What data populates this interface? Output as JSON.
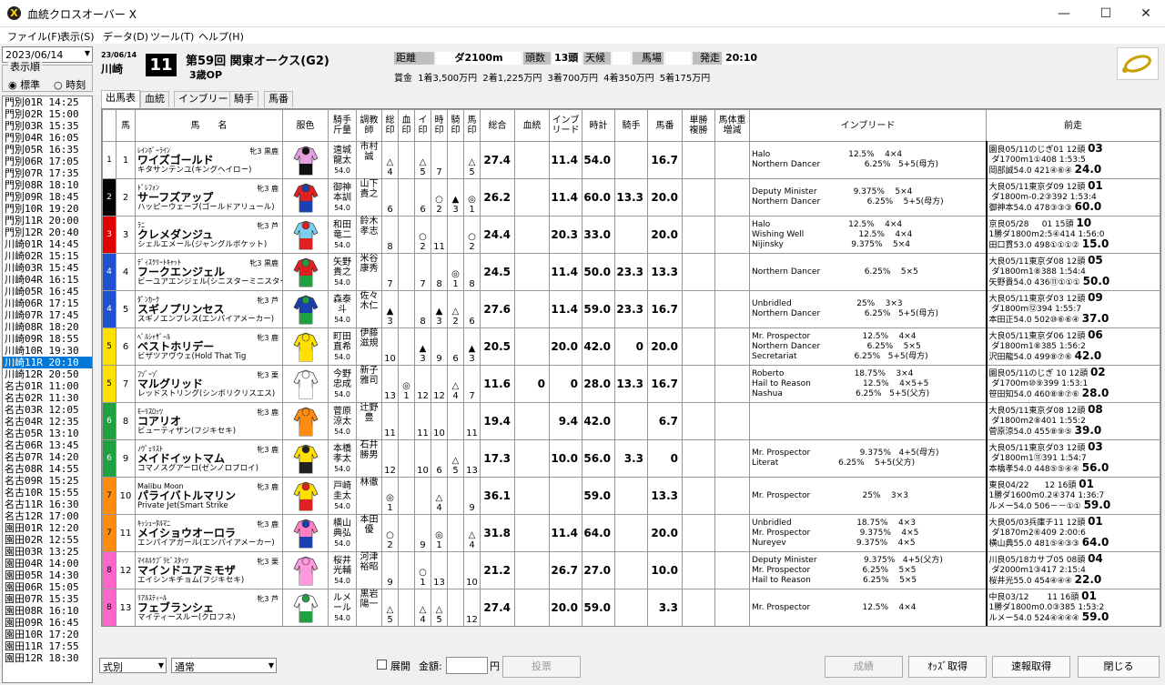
{
  "app": {
    "title": "血統クロスオーバー X",
    "win_min": "—",
    "win_max": "☐",
    "win_close": "✕"
  },
  "menu": [
    "ファイル(F)",
    "表示(S)",
    "データ(D)",
    "ツール(T)",
    "ヘルプ(H)"
  ],
  "left": {
    "date": "2023/06/14",
    "order_title": "表示順",
    "order_options": [
      "標準",
      "時刻"
    ],
    "order_selected": "標準",
    "races": [
      "門別01R 14:25",
      "門別02R 15:00",
      "門別03R 15:35",
      "門別04R 16:05",
      "門別05R 16:35",
      "門別06R 17:05",
      "門別07R 17:35",
      "門別08R 18:10",
      "門別09R 18:45",
      "門別10R 19:20",
      "門別11R 20:00",
      "門別12R 20:40",
      "川崎01R 14:45",
      "川崎02R 15:15",
      "川崎03R 15:45",
      "川崎04R 16:15",
      "川崎05R 16:45",
      "川崎06R 17:15",
      "川崎07R 17:45",
      "川崎08R 18:20",
      "川崎09R 18:55",
      "川崎10R 19:30",
      "川崎11R 20:10",
      "川崎12R 20:50",
      "名古01R 11:00",
      "名古02R 11:30",
      "名古03R 12:05",
      "名古04R 12:35",
      "名古05R 13:10",
      "名古06R 13:45",
      "名古07R 14:20",
      "名古08R 14:55",
      "名古09R 15:25",
      "名古10R 15:55",
      "名古11R 16:30",
      "名古12R 17:00",
      "園田01R 12:20",
      "園田02R 12:55",
      "園田03R 13:25",
      "園田04R 14:00",
      "園田05R 14:30",
      "園田06R 15:05",
      "園田07R 15:35",
      "園田08R 16:10",
      "園田09R 16:45",
      "園田10R 17:20",
      "園田11R 17:55",
      "園田12R 18:30"
    ],
    "selected": 22
  },
  "race": {
    "date": "23/06/14",
    "course": "川崎",
    "num": "11",
    "name": "第59回 関東オークス(G2)",
    "class": "3歳OP",
    "dist_lbl": "距離",
    "dist": "ダ2100m",
    "heads_lbl": "頭数",
    "heads": "13頭",
    "weather_lbl": "天候",
    "weather": "",
    "track_lbl": "馬場",
    "track": "",
    "start_lbl": "発走",
    "start": "20:10",
    "prize": "賞金 1着3,500万円 2着1,225万円 3着700万円 4着350万円 5着175万円"
  },
  "tabs": [
    "出馬表",
    "血統",
    "インブリード",
    "騎手",
    "馬番"
  ],
  "columns": [
    "",
    "馬",
    "馬　　名",
    "服色",
    "騎手\n斤量",
    "調教\n師",
    "総\n印",
    "血\n印",
    "イ\n印",
    "時\n印",
    "騎\n印",
    "馬\n印",
    "総合",
    "血統",
    "インブ\nリード",
    "時計",
    "騎手",
    "馬番",
    "単勝\n複勝",
    "馬体重\n増減",
    "インブリード",
    "前走"
  ],
  "horses": [
    {
      "waku": "1",
      "wc": "#ffffff",
      "wt": "#000",
      "no": "1",
      "sire": "ﾚｲﾝﾎﾞｰﾗｲﾝ",
      "name": "ワイズゴールド",
      "dam": "キタサンテンユ(キングヘイロー)",
      "sex": "牝3 黒鹿",
      "jockey": "遠城\n龍太",
      "kin": "54.0",
      "trainer": "市村\n誠",
      "m": [
        "△",
        "",
        "△",
        "",
        "",
        "△"
      ],
      "mk2": [
        "4",
        "",
        "5",
        "7",
        "",
        "5"
      ],
      "total": "27.4",
      "blood": "",
      "inbr": "11.4",
      "time": "54.0",
      "jk": "",
      "ban": "16.7",
      "inb": "Halo                              12.5%    4×4\nNorthern Dancer                 6.25%   5+5(母方)",
      "prev": "園良05/11のじぎ01 12頭 <b>03</b>\n ダ1700m1①408 1:53:5\n岡部誠54.0 421④⑥④ <b>24.0</b>",
      "silk": [
        "#111",
        "#e6a0e0",
        "#e6a0e0"
      ]
    },
    {
      "waku": "2",
      "wc": "#000000",
      "wt": "#fff",
      "no": "2",
      "sire": "ﾄﾞﾚﾌｫﾝ",
      "name": "サーフズアップ",
      "dam": "ハッピーウェーブ(ゴールドアリュール)",
      "sex": "牝3 鹿",
      "jockey": "御神\n本訓",
      "kin": "54.0",
      "trainer": "山下\n貴之",
      "m": [
        "",
        "",
        "",
        "○",
        "▲",
        "◎"
      ],
      "mk2": [
        "6",
        "",
        "6",
        "2",
        "3",
        "1"
      ],
      "total": "26.2",
      "blood": "",
      "inbr": "11.4",
      "time": "60.0",
      "jk": "13.3",
      "ban": "20.0",
      "inb": "Deputy Minister              9.375%    5×4\nNorthern Dancer                  6.25%    5+5(母方)",
      "prev": "大良05/11東京ダ09 12頭 <b>01</b>\n ダ1800m-0.2③392 1:53:4\n御神本54.0 478③③③ <b>60.0</b>",
      "silk": [
        "#1a3fb0",
        "#e02020",
        "#e02020"
      ]
    },
    {
      "waku": "3",
      "wc": "#e00000",
      "wt": "#fff",
      "no": "3",
      "sire": "ﾗﾆ",
      "name": "クレメダンジュ",
      "dam": "シェルエメール(ジャングルポケット)",
      "sex": "牝3 芦",
      "jockey": "和田\n竜二",
      "kin": "54.0",
      "trainer": "鈴木\n孝志",
      "m": [
        "",
        "",
        "○",
        "",
        "",
        "○"
      ],
      "mk2": [
        "8",
        "",
        "2",
        "11",
        "",
        "2"
      ],
      "total": "24.4",
      "blood": "",
      "inbr": "20.3",
      "time": "33.0",
      "jk": "",
      "ban": "20.0",
      "inb": "Halo                              12.5%    4×4\nWishing Well                     12.5%    4×4\nNijinsky                          9.375%    5×4",
      "prev": "京良05/28     01 15頭 <b>10</b>\n1勝ダ1800m2:5④414 1:56:0\n田口貫53.0 498①①①② <b>15.0</b>",
      "silk": [
        "#e02020",
        "#7ad0f0",
        "#7ad0f0"
      ]
    },
    {
      "waku": "4",
      "wc": "#1e50d0",
      "wt": "#fff",
      "no": "4",
      "sire": "ﾃﾞｨｽｸﾘｰﾄｷｬｯﾄ",
      "name": "フークエンジェル",
      "dam": "ビーユアエンジェル(シニスターミニスター)",
      "sex": "牝3 黒鹿",
      "jockey": "矢野\n貴之",
      "kin": "54.0",
      "trainer": "米谷\n康秀",
      "m": [
        "",
        "",
        "",
        "",
        "◎",
        ""
      ],
      "mk2": [
        "7",
        "",
        "7",
        "8",
        "1",
        "8"
      ],
      "total": "24.5",
      "blood": "",
      "inbr": "11.4",
      "time": "50.0",
      "jk": "23.3",
      "ban": "13.3",
      "inb": "Northern Dancer                 6.25%    5×5",
      "prev": "大良05/11東京ダ08 12頭 <b>05</b>\n ダ1800m1⑧388 1:54:4\n矢野貴54.0 436⑪①①① <b>50.0</b>",
      "silk": [
        "#20a040",
        "#e02020",
        "#e02020"
      ]
    },
    {
      "waku": "4",
      "wc": "#1e50d0",
      "wt": "#fff",
      "no": "5",
      "sire": "ﾀﾞﾝｶｰｸ",
      "name": "スギノプリンセス",
      "dam": "スギノエンブレス(エンパイアメーカー)",
      "sex": "牝3 芦",
      "jockey": "森泰\n斗",
      "kin": "54.0",
      "trainer": "佐々\n木仁",
      "m": [
        "▲",
        "",
        "",
        "▲",
        "△",
        ""
      ],
      "mk2": [
        "3",
        "",
        "8",
        "3",
        "2",
        "6"
      ],
      "total": "27.6",
      "blood": "",
      "inbr": "11.4",
      "time": "59.0",
      "jk": "23.3",
      "ban": "16.7",
      "inb": "Unbridled                         25%    3×3\nNorthern Dancer                 6.25%   5+5(母方)",
      "prev": "大良05/11東京ダ03 12頭 <b>09</b>\n ダ1800m⑫394 1:55:7\n本田正54.0 502⑩⑥⑥④ <b>37.0</b>",
      "silk": [
        "#20a040",
        "#1a3fb0",
        "#1a3fb0"
      ]
    },
    {
      "waku": "5",
      "wc": "#ffe000",
      "wt": "#000",
      "no": "6",
      "sire": "ﾍﾞﾙｼｬｻﾞｰﾙ",
      "name": "ベストホリデー",
      "dam": "ビザツアヴウェ(Hold That Tig",
      "sex": "牝3 鹿",
      "jockey": "町田\n直希",
      "kin": "54.0",
      "trainer": "伊藤\n滋規",
      "m": [
        "",
        "",
        "▲",
        "",
        "",
        "▲"
      ],
      "mk2": [
        "10",
        "",
        "3",
        "9",
        "6",
        "3"
      ],
      "total": "20.5",
      "blood": "",
      "inbr": "20.0",
      "time": "42.0",
      "jk": "0",
      "ban": "20.0",
      "inb": "Mr. Prospector                    12.5%    4×4\nNorthern Dancer                  6.25%    5×5\nSecretariat                      6.25%   5+5(母方)",
      "prev": "大良05/11東京ダ06 12頭 <b>06</b>\n ダ1800m1⑧385 1:56:2\n沢田龍54.0 499⑧⑦⑥ <b>42.0</b>",
      "silk": [
        "#ffe000",
        "#ffe000",
        "#ffe000"
      ]
    },
    {
      "waku": "5",
      "wc": "#ffe000",
      "wt": "#000",
      "no": "7",
      "sire": "ﾌｿﾞｰｿﾞ",
      "name": "マルグリッド",
      "dam": "レッドストリング(シンボリクリスエス)",
      "sex": "牝3 栗",
      "jockey": "今野\n忠成",
      "kin": "54.0",
      "trainer": "新子\n雅司",
      "m": [
        "",
        "◎",
        "",
        "",
        "△",
        ""
      ],
      "mk2": [
        "13",
        "1",
        "12",
        "12",
        "4",
        "7"
      ],
      "total": "11.6",
      "blood": "0",
      "inbr": "0",
      "time": "28.0",
      "jk": "13.3",
      "ban": "16.7",
      "inb": "Roberto                           18.75%    3×4\nHail to Reason                    12.5%    4×5+5\nNashua                            6.25%   5+5(父方)",
      "prev": "園良05/11のじぎ 10 12頭 <b>02</b>\n ダ1700m⑩⑨399 1:53:1\n笹田知54.0 460⑧⑧⑦⑥ <b>28.0</b>",
      "silk": [
        "#ffffff",
        "#ffffff",
        "#ffffff"
      ]
    },
    {
      "waku": "6",
      "wc": "#20a040",
      "wt": "#fff",
      "no": "8",
      "sire": "ﾓｰﾘｽﾛｯﾂ",
      "name": "コアリオ",
      "dam": "ビューティザン(フジキセキ)",
      "sex": "牝3 鹿",
      "jockey": "菅原\n涼太",
      "kin": "54.0",
      "trainer": "辻野\n豊",
      "m": [
        "",
        "",
        "",
        "",
        "",
        ""
      ],
      "mk2": [
        "11",
        "",
        "11",
        "10",
        "",
        "11"
      ],
      "total": "19.4",
      "blood": "",
      "inbr": "9.4",
      "time": "42.0",
      "jk": "",
      "ban": "6.7",
      "inb": "",
      "prev": "大良05/11東京ダ08 12頭 <b>08</b>\n ダ1800m2⑧401 1:55:2\n菅原涼54.0 455⑧⑨⑤ <b>39.0</b>",
      "silk": [
        "#ff8c10",
        "#ff8c10",
        "#ff8c10"
      ]
    },
    {
      "waku": "6",
      "wc": "#20a040",
      "wt": "#fff",
      "no": "9",
      "sire": "ﾉｳﾞｪﾘｽﾄ",
      "name": "メイドイットマム",
      "dam": "コマノスグアーロ(ゼンノロブロイ)",
      "sex": "牝3 鹿",
      "jockey": "本橋\n孝太",
      "kin": "54.0",
      "trainer": "石井\n勝男",
      "m": [
        "",
        "",
        "",
        "",
        "△",
        ""
      ],
      "mk2": [
        "12",
        "",
        "10",
        "6",
        "5",
        "13"
      ],
      "total": "17.3",
      "blood": "",
      "inbr": "10.0",
      "time": "56.0",
      "jk": "3.3",
      "ban": "0",
      "inb": "Mr. Prospector                   9.375%   4+5(母方)\nLiterat                       6.25%    5+5(父方)",
      "prev": "大良05/11東京ダ03 12頭 <b>03</b>\n ダ1800m1⑪391 1:54:7\n本橋孝54.0 448⑤⑤④④ <b>56.0</b>",
      "silk": [
        "#222222",
        "#ffe000",
        "#ffe000"
      ]
    },
    {
      "waku": "7",
      "wc": "#ff8c10",
      "wt": "#000",
      "no": "10",
      "sire": "Malibu Moon",
      "name": "パライバトルマリン",
      "dam": "Private Jet(Smart Strike",
      "sex": "牝3 鹿",
      "jockey": "戸崎\n圭太",
      "kin": "54.0",
      "trainer": "林徹",
      "m": [
        "◎",
        "",
        "",
        "△",
        "",
        ""
      ],
      "mk2": [
        "1",
        "",
        "",
        "4",
        "",
        "9"
      ],
      "total": "36.1",
      "blood": "",
      "inbr": "",
      "time": "59.0",
      "jk": "",
      "ban": "13.3",
      "inb": "Mr. Prospector                    25%    3×3",
      "prev": "東良04/22      12 16頭 <b>01</b>\n1勝ダ1600m0.2④374 1:36:7\nルメー54.0 506－－①① <b>59.0</b>",
      "silk": [
        "#e02020",
        "#ffe000",
        "#ffe000"
      ]
    },
    {
      "waku": "7",
      "wc": "#ff8c10",
      "wt": "#000",
      "no": "11",
      "sire": "ｷｯｼｭｰﾀﾙﾏﾆ",
      "name": "メイショウオーロラ",
      "dam": "エンパイアガール(エンパイアメーカー)",
      "sex": "牝3 鹿",
      "jockey": "横山\n典弘",
      "kin": "54.0",
      "trainer": "本田\n優",
      "m": [
        "○",
        "",
        "",
        "◎",
        "",
        "△"
      ],
      "mk2": [
        "2",
        "",
        "9",
        "1",
        "",
        "4"
      ],
      "total": "31.8",
      "blood": "",
      "inbr": "11.4",
      "time": "64.0",
      "jk": "",
      "ban": "20.0",
      "inb": "Unbridled                         18.75%    4×3\nMr. Prospector                   9.375%    4×5\nNureyev                           9.375%    4×5",
      "prev": "大良05/03兵庫チ11 12頭 <b>01</b>\n ダ1870m2⑥409 2:00:6\n横山典55.0 481⑤④③③ <b>64.0</b>",
      "silk": [
        "#1a3fb0",
        "#ff80c0",
        "#ff80c0"
      ]
    },
    {
      "waku": "8",
      "wc": "#ff66cc",
      "wt": "#000",
      "no": "12",
      "sire": "ﾏｲﾈﾙｸﾌﾞﾗﾋﾞｽﾀｯﾂ",
      "name": "マインドユアミモザ",
      "dam": "エイシンキチョム(フジキセキ)",
      "sex": "牝3 栗",
      "jockey": "桜井\n光輔",
      "kin": "54.0",
      "trainer": "河津\n裕昭",
      "m": [
        "",
        "",
        "○",
        "",
        "",
        ""
      ],
      "mk2": [
        "9",
        "",
        "1",
        "13",
        "",
        "10"
      ],
      "total": "21.2",
      "blood": "",
      "inbr": "26.7",
      "time": "27.0",
      "jk": "",
      "ban": "10.0",
      "inb": "Deputy Minister                  9.375%   4+5(父方)\nMr. Prospector                    6.25%    5×5\nHail to Reason                    6.25%    5×5",
      "prev": "川良05/18カサブ05 08頭 <b>04</b>\n ダ2000m1③417 2:15:4\n桜井光55.0 454④④④ <b>22.0</b>",
      "silk": [
        "#ff99dd",
        "#ff99dd",
        "#ff99dd"
      ]
    },
    {
      "waku": "8",
      "wc": "#ff66cc",
      "wt": "#000",
      "no": "13",
      "sire": "ﾘｱﾙｽﾃｨｰﾙ",
      "name": "フェブランシェ",
      "dam": "マイティースルー(クロフネ)",
      "sex": "牝3 芦",
      "jockey": "ルメ\nール",
      "kin": "54.0",
      "trainer": "黒岩\n陽一",
      "m": [
        "△",
        "",
        "△",
        "△",
        "",
        ""
      ],
      "mk2": [
        "5",
        "",
        "4",
        "5",
        "",
        "12"
      ],
      "total": "27.4",
      "blood": "",
      "inbr": "20.0",
      "time": "59.0",
      "jk": "",
      "ban": "3.3",
      "inb": "Mr. Prospector                    12.5%    4×4",
      "prev": "中良03/12       11 16頭 <b>01</b>\n1勝ダ1800m0.0③385 1:53:2\nルメー54.0 524④④④④ <b>59.0</b>",
      "silk": [
        "#20a040",
        "#ffffff",
        "#ffffff"
      ]
    }
  ],
  "bottom": {
    "sel1": "式別",
    "sel2": "通常",
    "tenkai": "展開",
    "amount_lbl": "金額:",
    "yen": "円",
    "vote": "投票",
    "seiseki": "成績",
    "odds": "ｵｯｽﾞ取得",
    "sokuho": "速報取得",
    "close": "閉じる"
  }
}
